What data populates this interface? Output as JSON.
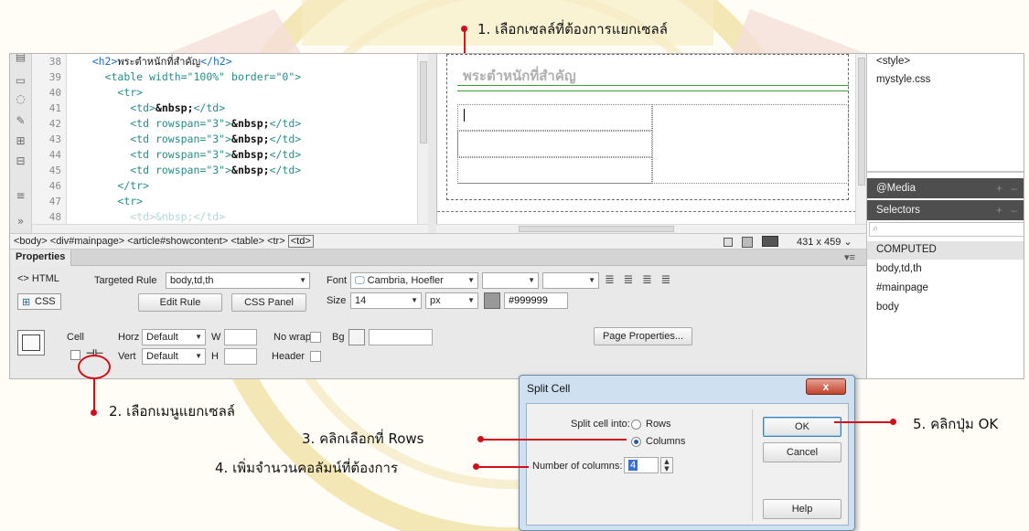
{
  "annotations": {
    "step1": "1. เลือกเซลล์ที่ต้องการแยกเซลล์",
    "step2": "2. เลือกเมนูแยกเซลล์",
    "step3": "3. คลิกเลือกที่ Rows",
    "step4": "4. เพิ่มจำนวนคอลัมน์ที่ต้องการ",
    "step5": "5. คลิกปุ่ม OK"
  },
  "code_view": {
    "lines": [
      {
        "num": "38",
        "indent": "    ",
        "open": "<h2>",
        "text": "พระตำหนักที่สำคัญ",
        "close": "</h2>"
      },
      {
        "num": "39",
        "indent": "      ",
        "code": "<table width=\"100%\" border=\"0\">"
      },
      {
        "num": "40",
        "indent": "        ",
        "code": "<tr>"
      },
      {
        "num": "41",
        "indent": "          ",
        "open": "<td>",
        "ent": "&nbsp;",
        "close": "</td>"
      },
      {
        "num": "42",
        "indent": "          ",
        "open": "<td rowspan=\"3\">",
        "ent": "&nbsp;",
        "close": "</td>"
      },
      {
        "num": "43",
        "indent": "          ",
        "open": "<td rowspan=\"3\">",
        "ent": "&nbsp;",
        "close": "</td>"
      },
      {
        "num": "44",
        "indent": "          ",
        "open": "<td rowspan=\"3\">",
        "ent": "&nbsp;",
        "close": "</td>"
      },
      {
        "num": "45",
        "indent": "          ",
        "open": "<td rowspan=\"3\">",
        "ent": "&nbsp;",
        "close": "</td>"
      },
      {
        "num": "46",
        "indent": "        ",
        "code": "</tr>"
      },
      {
        "num": "47",
        "indent": "        ",
        "code": "<tr>"
      },
      {
        "num": "48",
        "indent": "          ",
        "code": "<td>&nbsp;</td>"
      }
    ]
  },
  "design_view": {
    "heading": "พระตำหนักที่สำคัญ"
  },
  "status_bar": {
    "breadcrumb": [
      "<body>",
      "<div#mainpage>",
      "<article#showcontent>",
      "<table>",
      "<tr>",
      "<td>"
    ],
    "dimensions": "431 x 459"
  },
  "right_panel": {
    "sources": [
      "<style>",
      "mystyle.css"
    ],
    "media_label": "@Media",
    "selectors_label": "Selectors",
    "computed_label": "COMPUTED",
    "computed_items": [
      "body,td,th",
      "#mainpage",
      "body"
    ]
  },
  "properties": {
    "title": "Properties",
    "html_label": "<> HTML",
    "css_label": "CSS",
    "targeted_rule_label": "Targeted Rule",
    "targeted_rule_value": "body,td,th",
    "edit_rule": "Edit Rule",
    "css_panel": "CSS Panel",
    "font_label": "Font",
    "font_value": "Cambria, Hoefler ",
    "size_label": "Size",
    "size_value": "14",
    "size_unit": "px",
    "color_value": "#999999",
    "cell_label": "Cell",
    "horz_label": "Horz",
    "horz_value": "Default",
    "vert_label": "Vert",
    "vert_value": "Default",
    "w_label": "W",
    "h_label": "H",
    "nowrap_label": "No wrap",
    "bg_label": "Bg",
    "header_label": "Header",
    "page_properties": "Page Properties..."
  },
  "dialog": {
    "title": "Split Cell",
    "close": "x",
    "split_into_label": "Split cell into:",
    "rows_option": "Rows",
    "columns_option": "Columns",
    "selected_option": "Columns",
    "number_label": "Number of columns:",
    "number_value": "4",
    "ok": "OK",
    "cancel": "Cancel",
    "help": "Help"
  },
  "colors": {
    "annotation_red": "#d10f1b",
    "tag_teal": "#2a8a8a",
    "panel_dark": "#4e4e4e",
    "dialog_frame": "#cfe0f1"
  }
}
